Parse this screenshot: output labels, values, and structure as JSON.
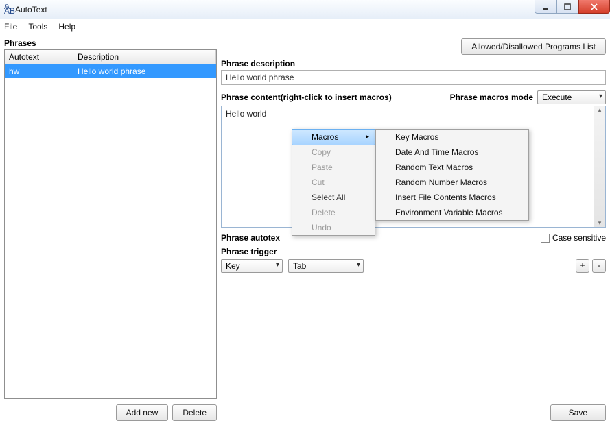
{
  "window": {
    "title": "AutoText"
  },
  "menu": {
    "file": "File",
    "tools": "Tools",
    "help": "Help"
  },
  "left": {
    "header": "Phrases",
    "col_autotext": "Autotext",
    "col_description": "Description",
    "rows": [
      {
        "autotext": "hw",
        "description": "Hello world phrase"
      }
    ],
    "add_new": "Add new",
    "delete": "Delete"
  },
  "right": {
    "allowed_btn": "Allowed/Disallowed Programs List",
    "desc_label": "Phrase description",
    "desc_value": "Hello world phrase",
    "content_label": "Phrase content(right-click to insert macros)",
    "macros_mode_label": "Phrase macros mode",
    "macros_mode_value": "Execute",
    "content_value": "Hello world",
    "autotext_label": "Phrase autotex",
    "case_sensitive": "Case sensitive",
    "trigger_label": "Phrase trigger",
    "trigger_type": "Key",
    "trigger_key": "Tab",
    "plus": "+",
    "minus": "-",
    "save": "Save"
  },
  "context_menu": {
    "macros": "Macros",
    "copy": "Copy",
    "paste": "Paste",
    "cut": "Cut",
    "select_all": "Select All",
    "delete": "Delete",
    "undo": "Undo"
  },
  "submenu": {
    "key": "Key Macros",
    "date": "Date And Time Macros",
    "random_text": "Random Text Macros",
    "random_number": "Random Number Macros",
    "insert_file": "Insert File Contents Macros",
    "env_var": "Environment Variable Macros"
  }
}
